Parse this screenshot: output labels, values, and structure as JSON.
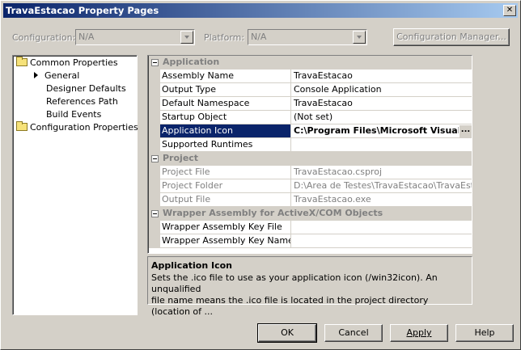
{
  "window": {
    "title": "TravaEstacao Property Pages"
  },
  "toolbar": {
    "configuration_label": "Configuration:",
    "configuration_value": "N/A",
    "platform_label": "Platform:",
    "platform_value": "N/A",
    "config_manager_label": "Configuration Manager..."
  },
  "tree": {
    "items": [
      {
        "label": "Common Properties"
      },
      {
        "label": "General"
      },
      {
        "label": "Designer Defaults"
      },
      {
        "label": "References Path"
      },
      {
        "label": "Build Events"
      },
      {
        "label": "Configuration Properties"
      }
    ]
  },
  "grid": {
    "categories": [
      {
        "label": "Application"
      },
      {
        "label": "Project"
      },
      {
        "label": "Wrapper Assembly for ActiveX/COM Objects"
      }
    ],
    "rows": [
      {
        "name": "Assembly Name",
        "value": "TravaEstacao"
      },
      {
        "name": "Output Type",
        "value": "Console Application"
      },
      {
        "name": "Default Namespace",
        "value": "TravaEstacao"
      },
      {
        "name": "Startup Object",
        "value": "(Not set)"
      },
      {
        "name": "Application Icon",
        "value": "C:\\Program Files\\Microsoft Visual St"
      },
      {
        "name": "Supported Runtimes",
        "value": ""
      },
      {
        "name": "Project File",
        "value": "TravaEstacao.csproj"
      },
      {
        "name": "Project Folder",
        "value": "D:\\Area de Testes\\TravaEstacao\\TravaEstaca"
      },
      {
        "name": "Output File",
        "value": "TravaEstacao.exe"
      },
      {
        "name": "Wrapper Assembly Key File",
        "value": ""
      },
      {
        "name": "Wrapper Assembly Key Name",
        "value": ""
      }
    ],
    "ellipsis_label": "..."
  },
  "description": {
    "title": "Application Icon",
    "text_line1": "Sets the .ico file to use as your application icon (/win32icon).  An unqualified",
    "text_line2": "file name means the .ico file is located in the project directory (location of ..."
  },
  "buttons": {
    "ok": "OK",
    "cancel": "Cancel",
    "apply": "Apply",
    "help": "Help"
  }
}
